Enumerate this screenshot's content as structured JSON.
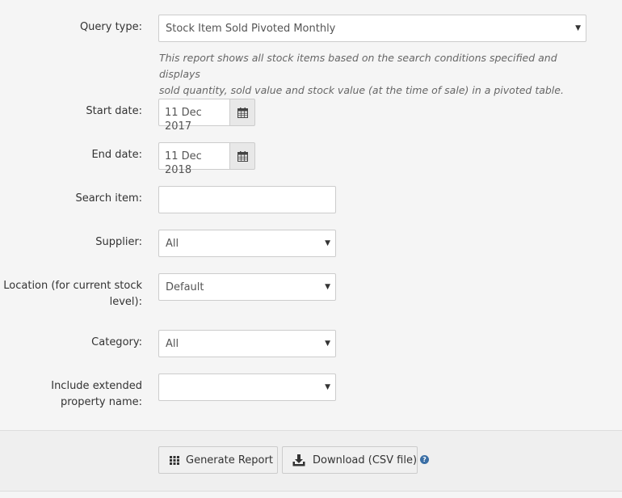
{
  "form": {
    "query_type": {
      "label": "Query type:",
      "value": "Stock Item Sold Pivoted Monthly",
      "help_line1": "This report shows all stock items based on the search conditions specified and displays",
      "help_line2": "sold quantity, sold value and stock value (at the time of sale) in a pivoted table."
    },
    "start_date": {
      "label": "Start date:",
      "value": "11 Dec 2017",
      "icon": "calendar-icon"
    },
    "end_date": {
      "label": "End date:",
      "value": "11 Dec 2018",
      "icon": "calendar-icon"
    },
    "search_item": {
      "label": "Search item:",
      "value": ""
    },
    "supplier": {
      "label": "Supplier:",
      "value": "All"
    },
    "location": {
      "label_line1": "Location (for current stock",
      "label_line2": "level):",
      "value": "Default"
    },
    "category": {
      "label": "Category:",
      "value": "All"
    },
    "extended_property": {
      "label_line1": "Include extended",
      "label_line2": "property name:",
      "value": ""
    }
  },
  "footer": {
    "generate_label": "Generate Report",
    "generate_icon": "grid-icon",
    "download_label": "Download (CSV file)",
    "download_icon": "download-icon",
    "help_icon": "question-circle-icon",
    "help_glyph": "?"
  }
}
